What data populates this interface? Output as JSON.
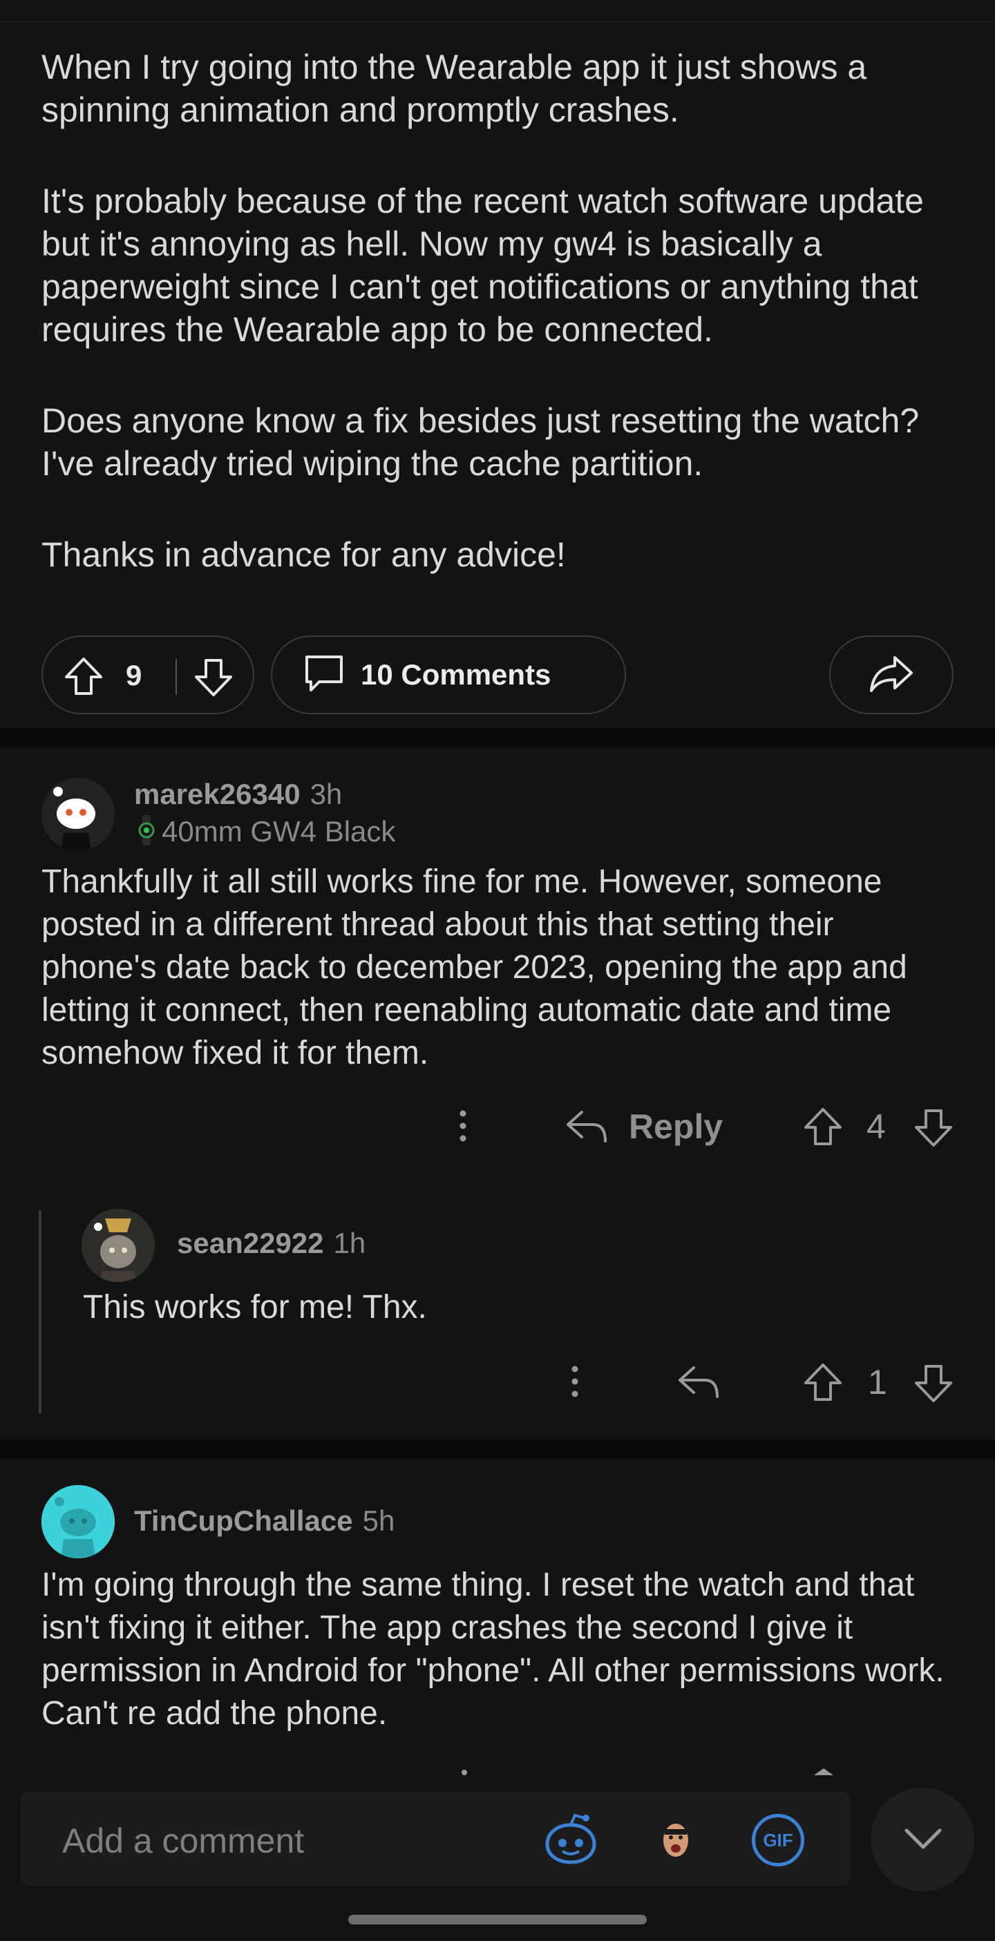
{
  "post": {
    "paragraphs": [
      "When I try going into the Wearable app it just shows a spinning animation and promptly crashes.",
      "It's probably because of the recent watch software update but it's annoying as hell. Now my gw4 is basically a paperweight since I can't get notifications or anything that requires the Wearable app to be connected.",
      "Does anyone know a fix besides just resetting the watch? I've already tried wiping the cache partition.",
      "Thanks in advance for any advice!"
    ],
    "votes": "9",
    "comments_label": "10 Comments"
  },
  "comments": [
    {
      "username": "marek26340",
      "time": "3h",
      "flair": "40mm GW4 Black",
      "text": "Thankfully it all still works fine for me. However, someone posted in a different thread about this that setting their phone's date back to december 2023, opening the app and letting it connect, then reenabling automatic date and time somehow fixed it for them.",
      "reply_label": "Reply",
      "votes": "4"
    },
    {
      "username": "sean22922",
      "time": "1h",
      "text": "This works for me! Thx.",
      "votes": "1"
    },
    {
      "username": "TinCupChallace",
      "time": "5h",
      "text": "I'm going through the same thing. I reset the watch and that isn't fixing it either. The app crashes the second I give it permission in Android for \"phone\". All other permissions work. Can't re add the phone."
    }
  ],
  "composer": {
    "placeholder": "Add a comment",
    "gif_label": "GIF"
  },
  "colors": {
    "background": "#131313",
    "text": "#d7dadc",
    "muted": "#8f8f8f",
    "accent": "#3b82d6"
  }
}
